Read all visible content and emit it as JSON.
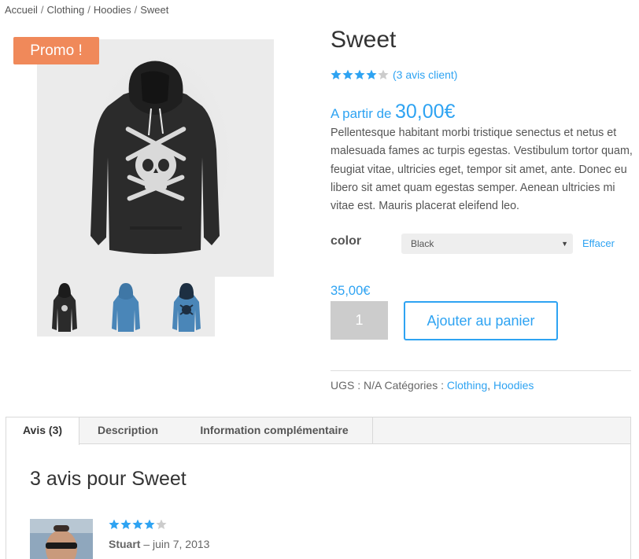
{
  "breadcrumb": {
    "items": [
      "Accueil",
      "Clothing",
      "Hoodies",
      "Sweet"
    ],
    "separator": "/"
  },
  "badge": {
    "label": "Promo !"
  },
  "product": {
    "title": "Sweet",
    "rating": 4,
    "rating_max": 5,
    "review_link": "(3 avis client)",
    "price_prefix": "A partir de",
    "price_amount": "30,00€",
    "description": "Pellentesque habitant morbi tristique senectus et netus et malesuada fames ac turpis egestas. Vestibulum tortor quam, feugiat vitae, ultricies eget, tempor sit amet, ante. Donec eu libero sit amet quam egestas semper. Aenean ultricies mi vitae est. Mauris placerat eleifend leo."
  },
  "variation": {
    "label": "color",
    "selected": "Black",
    "clear_label": "Effacer",
    "price": "35,00€"
  },
  "cart": {
    "quantity": "1",
    "add_label": "Ajouter au panier"
  },
  "meta": {
    "sku_label": "UGS :",
    "sku_value": "N/A",
    "categories_label": "Catégories :",
    "categories": [
      "Clothing",
      "Hoodies"
    ],
    "categories_sep": ","
  },
  "tabs": [
    {
      "label": "Avis (3)",
      "active": true
    },
    {
      "label": "Description",
      "active": false
    },
    {
      "label": "Information complémentaire",
      "active": false
    }
  ],
  "reviews": {
    "heading": "3 avis pour Sweet",
    "first": {
      "rating": 4,
      "author": "Stuart",
      "date_sep": "–",
      "date": "juin 7, 2013"
    }
  },
  "colors": {
    "accent": "#2ea3f2",
    "promo": "#f0895a",
    "star_filled": "#2ea3f2",
    "star_empty": "#cccccc",
    "hoodie_black": "#2b2b2b",
    "hoodie_blue": "#4a86b8"
  }
}
